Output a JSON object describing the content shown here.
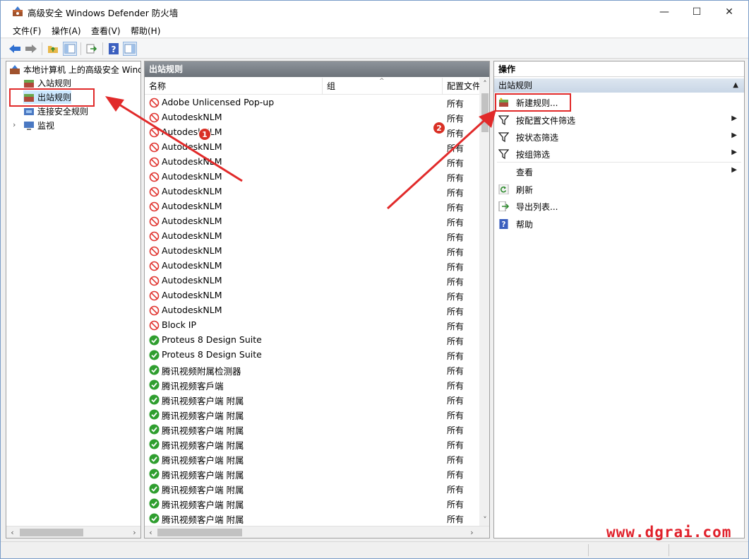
{
  "window": {
    "title": "高级安全 Windows Defender 防火墙",
    "controls": {
      "minimize": "—",
      "maximize": "☐",
      "close": "✕"
    }
  },
  "menu": [
    "文件(F)",
    "操作(A)",
    "查看(V)",
    "帮助(H)"
  ],
  "toolbar": {
    "icons": [
      "back-icon",
      "forward-icon",
      "up-folder-icon",
      "show-tree-icon",
      "export-icon",
      "help-icon",
      "show-action-pane-icon"
    ]
  },
  "tree": {
    "root": "本地计算机 上的高级安全 Windows Defender 防火墙",
    "items": [
      "入站规则",
      "出站规则",
      "连接安全规则",
      "监视"
    ],
    "selected": "出站规则"
  },
  "middle": {
    "header": "出站规则",
    "columns": {
      "name": "名称",
      "group": "组",
      "profile": "配置文件"
    },
    "rules": [
      {
        "name": "Adobe Unlicensed Pop-up",
        "profile": "所有",
        "action": "block"
      },
      {
        "name": "AutodeskNLM",
        "profile": "所有",
        "action": "block"
      },
      {
        "name": "AutodeskNLM",
        "profile": "所有",
        "action": "block"
      },
      {
        "name": "AutodeskNLM",
        "profile": "所有",
        "action": "block"
      },
      {
        "name": "AutodeskNLM",
        "profile": "所有",
        "action": "block"
      },
      {
        "name": "AutodeskNLM",
        "profile": "所有",
        "action": "block"
      },
      {
        "name": "AutodeskNLM",
        "profile": "所有",
        "action": "block"
      },
      {
        "name": "AutodeskNLM",
        "profile": "所有",
        "action": "block"
      },
      {
        "name": "AutodeskNLM",
        "profile": "所有",
        "action": "block"
      },
      {
        "name": "AutodeskNLM",
        "profile": "所有",
        "action": "block"
      },
      {
        "name": "AutodeskNLM",
        "profile": "所有",
        "action": "block"
      },
      {
        "name": "AutodeskNLM",
        "profile": "所有",
        "action": "block"
      },
      {
        "name": "AutodeskNLM",
        "profile": "所有",
        "action": "block"
      },
      {
        "name": "AutodeskNLM",
        "profile": "所有",
        "action": "block"
      },
      {
        "name": "AutodeskNLM",
        "profile": "所有",
        "action": "block"
      },
      {
        "name": "Block IP",
        "profile": "所有",
        "action": "block"
      },
      {
        "name": "Proteus 8 Design Suite",
        "profile": "所有",
        "action": "allow"
      },
      {
        "name": "Proteus 8 Design Suite",
        "profile": "所有",
        "action": "allow"
      },
      {
        "name": "腾讯视频附属检测器",
        "profile": "所有",
        "action": "allow"
      },
      {
        "name": "腾讯视频客戶端",
        "profile": "所有",
        "action": "allow"
      },
      {
        "name": "腾讯视频客户端 附属",
        "profile": "所有",
        "action": "allow"
      },
      {
        "name": "腾讯视频客户端 附属",
        "profile": "所有",
        "action": "allow"
      },
      {
        "name": "腾讯视频客户端 附属",
        "profile": "所有",
        "action": "allow"
      },
      {
        "name": "腾讯视频客户端 附属",
        "profile": "所有",
        "action": "allow"
      },
      {
        "name": "腾讯视频客户端 附属",
        "profile": "所有",
        "action": "allow"
      },
      {
        "name": "腾讯视频客户端 附属",
        "profile": "所有",
        "action": "allow"
      },
      {
        "name": "腾讯视频客户端 附属",
        "profile": "所有",
        "action": "allow"
      },
      {
        "name": "腾讯视频客户端 附属",
        "profile": "所有",
        "action": "allow"
      },
      {
        "name": "腾讯视频客户端 附属",
        "profile": "所有",
        "action": "allow"
      }
    ]
  },
  "actions_pane": {
    "header": "操作",
    "section": "出站规则",
    "items": [
      {
        "label": "新建规则...",
        "icon": "new-rule-icon",
        "submenu": false
      },
      {
        "label": "按配置文件筛选",
        "icon": "filter-icon",
        "submenu": true
      },
      {
        "label": "按状态筛选",
        "icon": "filter-icon",
        "submenu": true
      },
      {
        "label": "按组筛选",
        "icon": "filter-icon",
        "submenu": true
      },
      {
        "label": "查看",
        "icon": "",
        "submenu": true
      },
      {
        "label": "刷新",
        "icon": "refresh-icon",
        "submenu": false
      },
      {
        "label": "导出列表...",
        "icon": "export-list-icon",
        "submenu": false
      },
      {
        "label": "帮助",
        "icon": "help-icon",
        "submenu": false
      }
    ]
  },
  "annotations": {
    "badge1": "1",
    "badge2": "2",
    "color": "#e12a2a"
  },
  "watermark": "www.dgrai.com",
  "colors": {
    "block": "#e0342f",
    "allow": "#2f9e2f",
    "accent": "#e12a2a"
  }
}
